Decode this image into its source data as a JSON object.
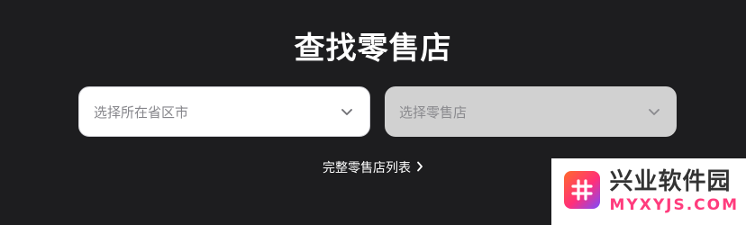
{
  "header": {
    "title": "查找零售店"
  },
  "province_select": {
    "placeholder": "选择所在省区市"
  },
  "store_select": {
    "placeholder": "选择零售店"
  },
  "full_list_link": {
    "label": "完整零售店列表"
  },
  "watermark": {
    "name_cn": "兴业软件园",
    "domain": "MYXYJS.COM"
  },
  "colors": {
    "background": "#1d1d1f",
    "select_enabled_bg": "#ffffff",
    "select_disabled_bg": "#d1d1d1",
    "watermark_accent": "#ff3c7d"
  }
}
